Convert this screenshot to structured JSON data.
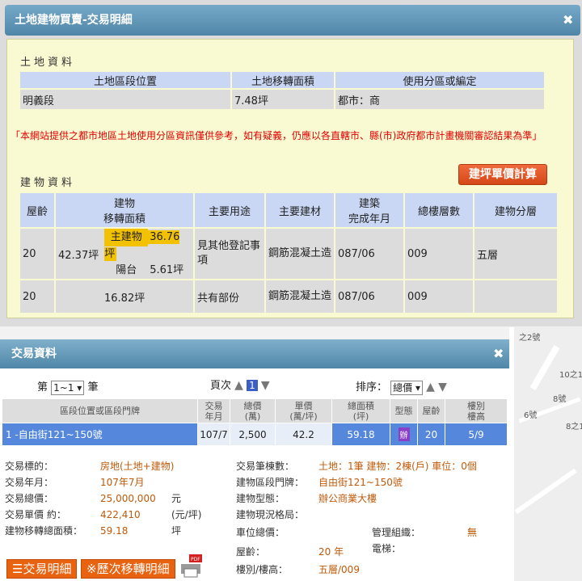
{
  "land_dialog": {
    "title": "土地建物買賣-交易明細",
    "land_section": "土地資料",
    "land_headers": [
      "土地區段位置",
      "土地移轉面積",
      "使用分區或編定"
    ],
    "land_row": [
      "明義段",
      "7.48坪",
      "都市：商"
    ],
    "notice": "「本網站提供之都市地區土地使用分區資訊僅供參考，如有疑義，仍應以各直轄市、縣(市)政府都市計畫機關審認結果為準」",
    "building_section": "建物資料",
    "calc_button": "建坪單價計算",
    "building_headers": {
      "age": "屋齡",
      "area": "建物\n移轉面積",
      "usage": "主要用途",
      "material": "主要建材",
      "completed": "建築\n完成年月",
      "floors": "總樓層數",
      "floor_split": "建物分層"
    },
    "building_rows": [
      {
        "age": "20",
        "area": "42.37坪",
        "main_label": "主建物",
        "main_value": "36.76坪",
        "balcony_label": "陽台",
        "balcony_value": "5.61坪",
        "usage": "見其他登記事項",
        "material": "鋼筋混凝土造",
        "completed": "087/06",
        "floors": "009",
        "floor_split": "五層"
      },
      {
        "age": "20",
        "area": "16.82坪",
        "usage": "共有部份",
        "material": "鋼筋混凝土造",
        "completed": "087/06",
        "floors": "009",
        "floor_split": ""
      }
    ]
  },
  "trade_dialog": {
    "title": "交易資料",
    "pager": {
      "prefix": "第",
      "value": "1~1",
      "suffix": "筆"
    },
    "page": {
      "label": "頁次",
      "current": "1"
    },
    "sort": {
      "label": "排序：",
      "value": "總價"
    },
    "table_headers": [
      "區段位置或區段門牌",
      "交易\n年月",
      "總價\n(萬)",
      "單價\n(萬/坪)",
      "總面積\n(坪)",
      "型態",
      "屋齡",
      "樓別\n樓高"
    ],
    "table_row": {
      "addr": "1 -自由街121~150號",
      "date": "107/7",
      "total": "2,500",
      "unit": "42.2",
      "area": "59.18",
      "type": "辦",
      "age": "20",
      "floor": "5/9"
    },
    "details_left": [
      {
        "k": "交易標的：",
        "v": "房地(土地+建物)",
        "u": ""
      },
      {
        "k": "交易年月：",
        "v": "107年7月",
        "u": ""
      },
      {
        "k": "交易總價：",
        "v": "25,000,000",
        "u": "元"
      },
      {
        "k": "交易單價 約：",
        "v": "422,410",
        "u": "(元/坪)"
      },
      {
        "k": "建物移轉總面積：",
        "v": "59.18",
        "u": "坪"
      }
    ],
    "details_right": [
      {
        "k": "交易筆棟數：",
        "v": "土地：1筆 建物：2棟(戶) 車位：0個"
      },
      {
        "k": "建物區段門牌：",
        "v": "自由街121~150號"
      },
      {
        "k": "建物型態：",
        "v": "辦公商業大樓"
      },
      {
        "k": "建物現況格局：",
        "v": ""
      },
      {
        "k": "車位總價：",
        "v": ""
      },
      {
        "k": "屋齡：",
        "v": "20 年"
      },
      {
        "k": "樓別/樓高：",
        "v": "五層/009"
      }
    ],
    "management": {
      "k": "管理組織：",
      "v": "無"
    },
    "elevator": {
      "k": "電梯：",
      "v": ""
    },
    "btn_detail": "交易明細",
    "btn_history": "※歷次移轉明細"
  },
  "map_labels": [
    "之2號",
    "10之1",
    "8號",
    "6號",
    "8之1"
  ],
  "colors": {
    "titlebar": "#5a8fb0",
    "accent_orange": "#e8620f",
    "row_highlight": "#5588dd",
    "value_text": "#c05a0a"
  }
}
